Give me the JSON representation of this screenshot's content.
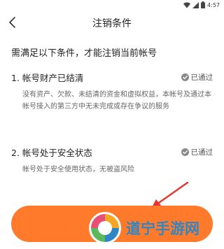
{
  "status_bar": {
    "time": "4:57"
  },
  "nav": {
    "title": "注销条件"
  },
  "requirement_text": "需满足以下条件，才能注销当前帐号",
  "conditions": [
    {
      "title": "1. 帐号财产已结清",
      "status": "已通过",
      "description": "没有资产、欠款、未结清的资金和虚拟权益，本帐号及通过本帐号接入的第三方中无未完成或存在争议的服务"
    },
    {
      "title": "2. 帐号处于安全状态",
      "status": "已通过",
      "description": "帐号处于安全使用状态，无被盗风险"
    }
  ],
  "watermark": {
    "text": "道宁手游网"
  },
  "colors": {
    "accent": "#ff7a2b",
    "watermark": "#2e86c4",
    "annotation": "#e8322a"
  },
  "icons": {
    "back": "chevron-left-icon",
    "passed": "check-circle-icon",
    "wifi": "wifi-icon",
    "signal": "signal-icon",
    "battery": "battery-icon"
  }
}
